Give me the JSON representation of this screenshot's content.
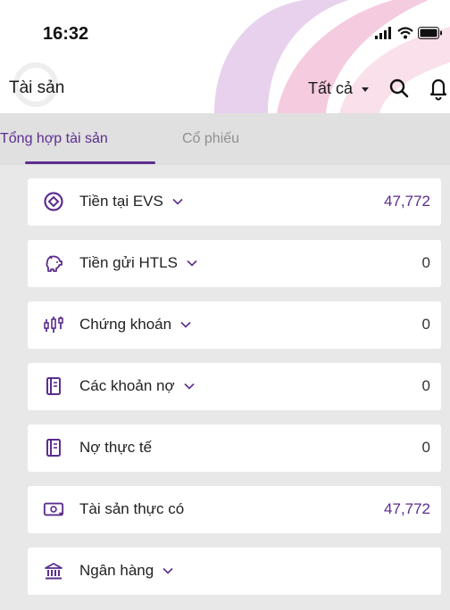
{
  "status_bar": {
    "time": "16:32"
  },
  "header": {
    "title": "Tài sản",
    "filter_label": "Tất cả"
  },
  "tabs": [
    {
      "label": "Tổng hợp tài sản",
      "active": true
    },
    {
      "label": "Cổ phiếu",
      "active": false
    }
  ],
  "cards": [
    {
      "icon": "target-icon",
      "label": "Tiền tại EVS",
      "expandable": true,
      "value": "47,772"
    },
    {
      "icon": "piggy-bank-icon",
      "label": "Tiền gửi HTLS",
      "expandable": true,
      "value": "0"
    },
    {
      "icon": "candlestick-icon",
      "label": "Chứng khoán",
      "expandable": true,
      "value": "0"
    },
    {
      "icon": "ledger-icon",
      "label": "Các khoản nợ",
      "expandable": true,
      "value": "0"
    },
    {
      "icon": "ledger-icon",
      "label": "Nợ thực tế",
      "expandable": false,
      "value": "0"
    },
    {
      "icon": "banknote-icon",
      "label": "Tài sản thực có",
      "expandable": false,
      "value": "47,772"
    },
    {
      "icon": "bank-icon",
      "label": "Ngân hàng",
      "expandable": true,
      "value": ""
    }
  ],
  "colors": {
    "accent": "#5c2d8e",
    "page_background": "#e8e8e8",
    "card_background": "#ffffff"
  }
}
